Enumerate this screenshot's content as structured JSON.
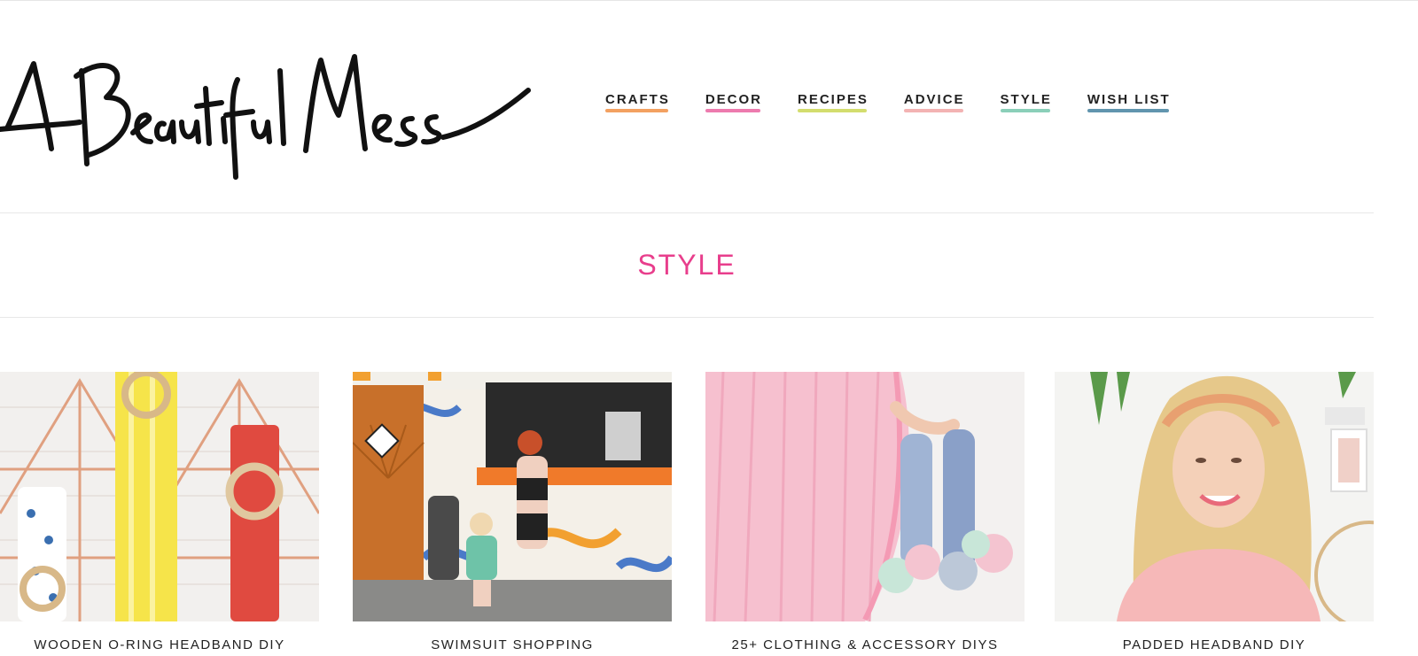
{
  "brand": {
    "logo_text": "A Beautiful Mess"
  },
  "nav": {
    "items": [
      {
        "label": "CRAFTS",
        "underline": "#f08a3a"
      },
      {
        "label": "DECOR",
        "underline": "#e85a9a"
      },
      {
        "label": "RECIPES",
        "underline": "#c8d44a"
      },
      {
        "label": "ADVICE",
        "underline": "#f0a0a0"
      },
      {
        "label": "STYLE",
        "underline": "#6ec3a8"
      },
      {
        "label": "WISH LIST",
        "underline": "#3a7a9a"
      }
    ]
  },
  "page": {
    "title": "STYLE",
    "title_color": "#e83e8c"
  },
  "posts": [
    {
      "title": "WOODEN O-RING HEADBAND DIY"
    },
    {
      "title": "SWIMSUIT SHOPPING"
    },
    {
      "title": "25+ CLOTHING & ACCESSORY DIYS"
    },
    {
      "title": "PADDED HEADBAND DIY"
    }
  ]
}
